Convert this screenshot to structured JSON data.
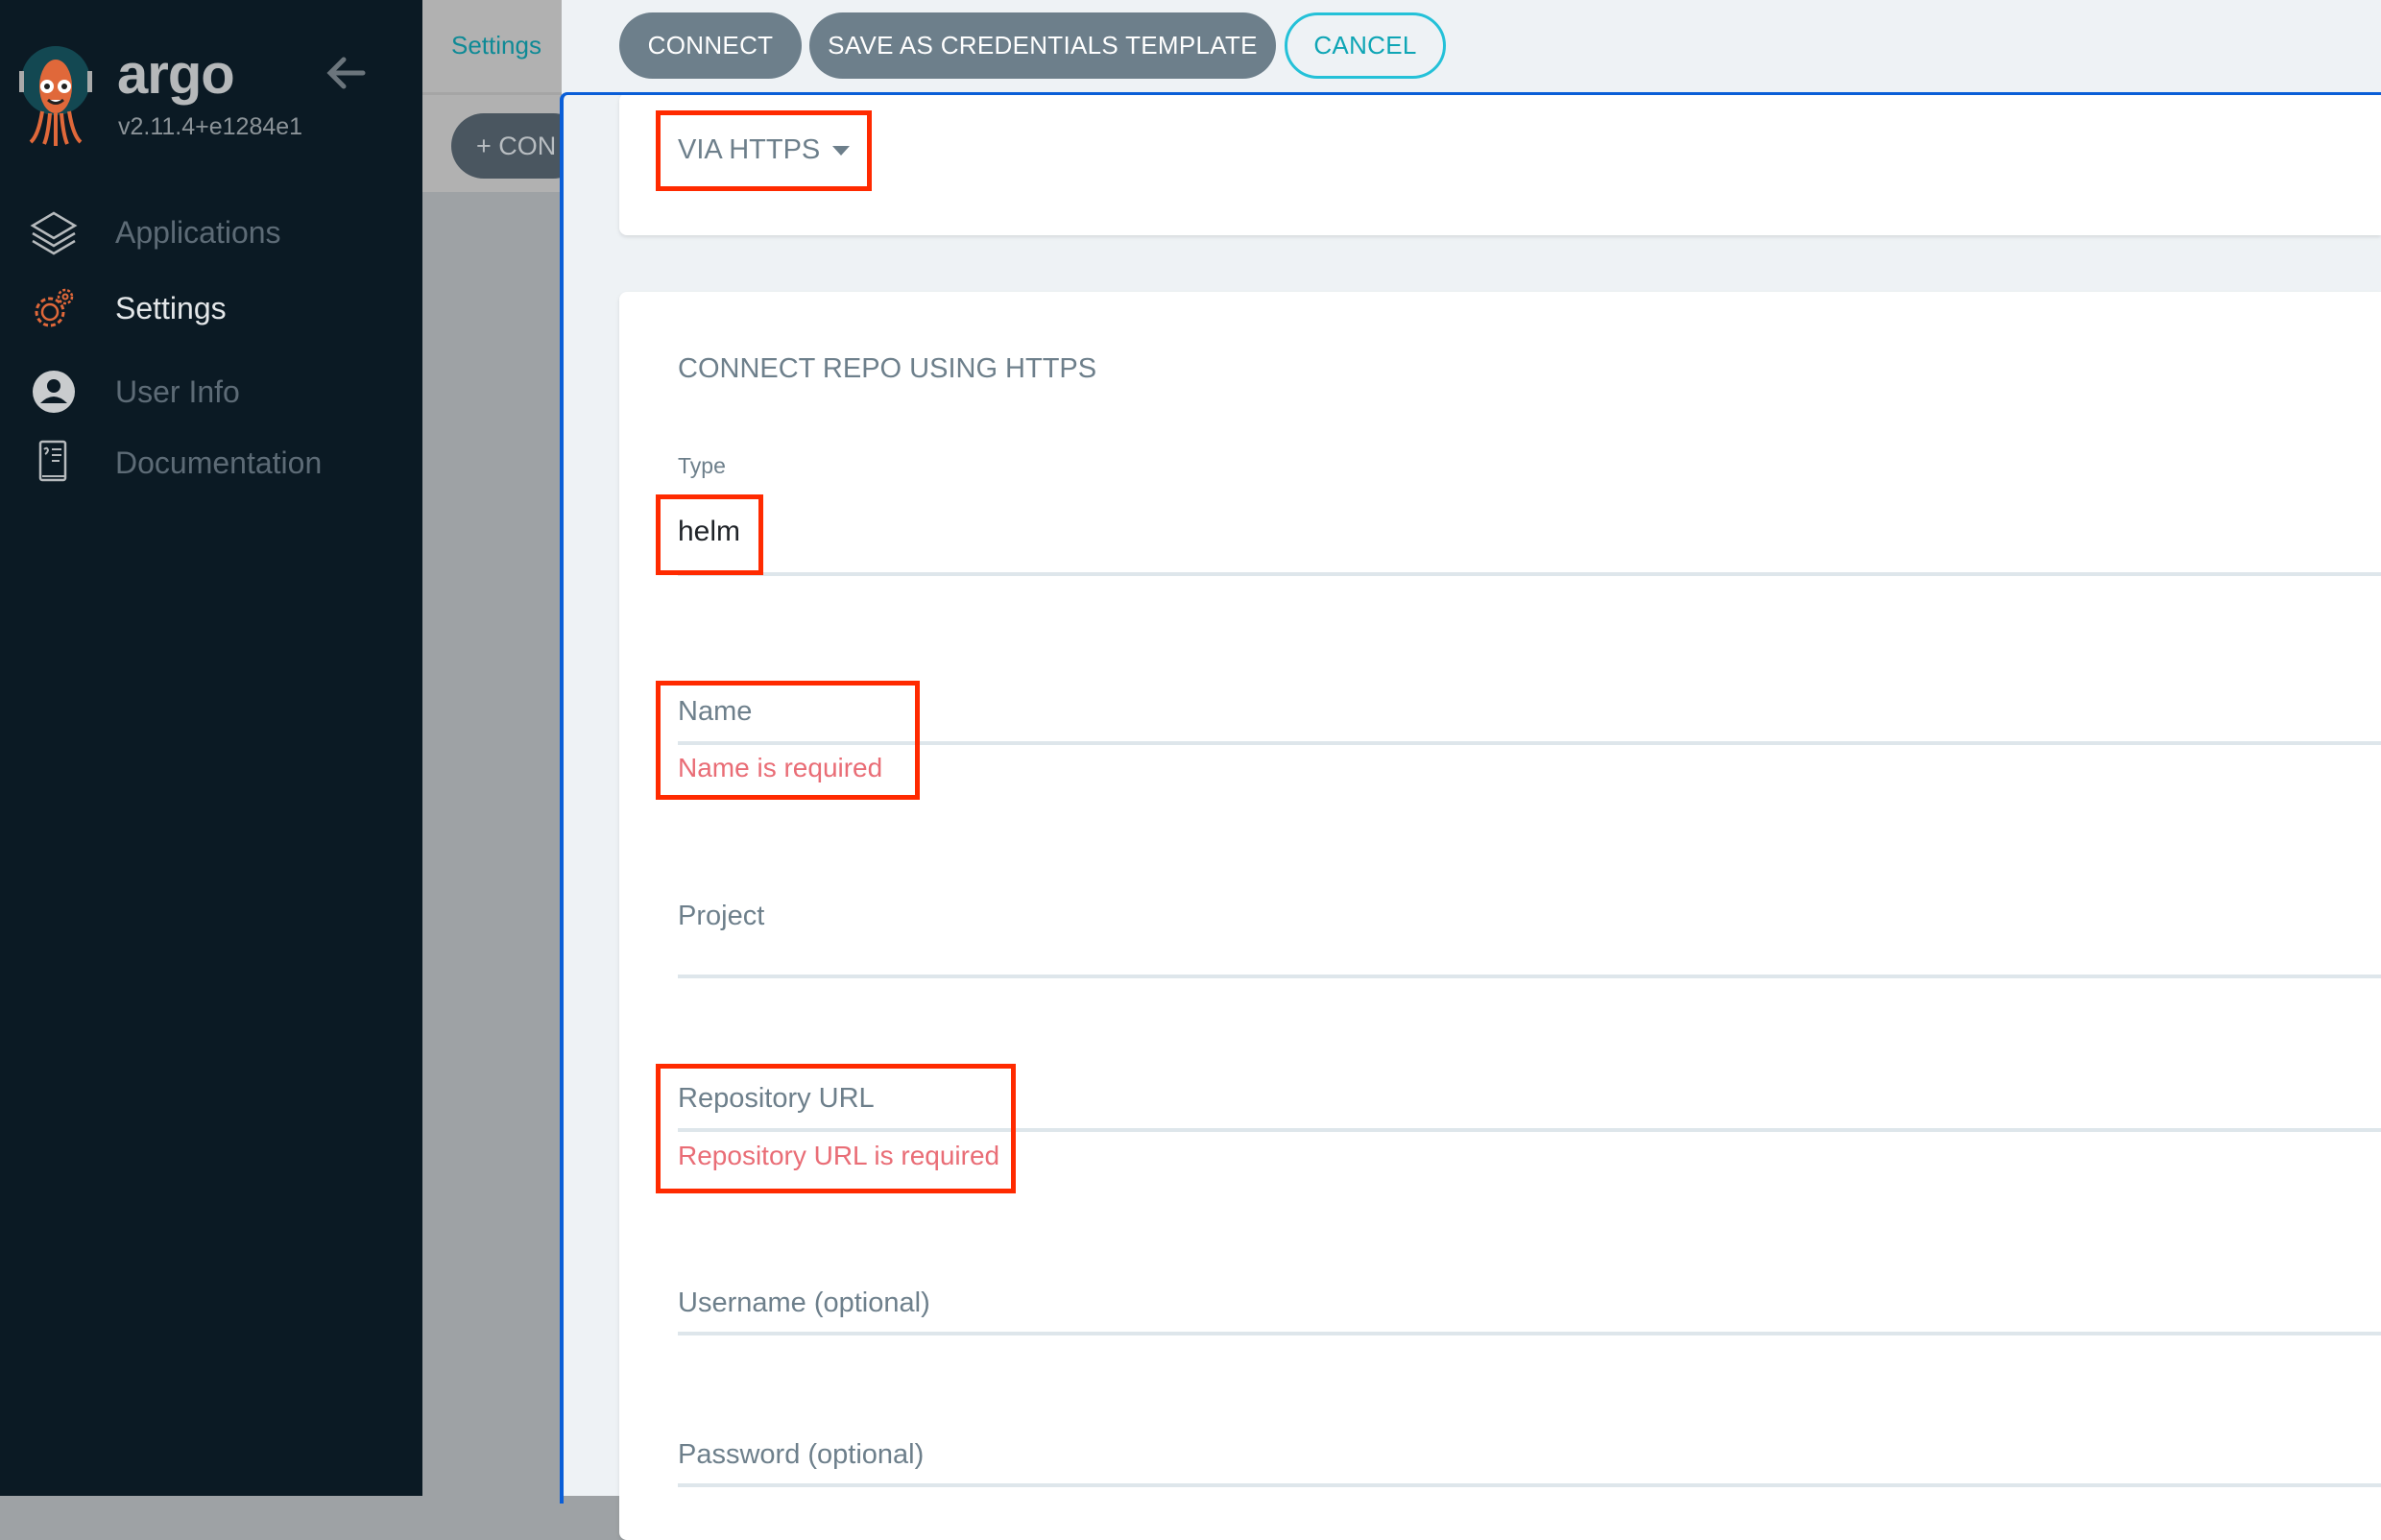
{
  "sidebar": {
    "brand": "argo",
    "version": "v2.11.4+e1284e1",
    "items": [
      {
        "label": "Applications",
        "icon": "layers-icon"
      },
      {
        "label": "Settings",
        "icon": "gears-icon",
        "active": true
      },
      {
        "label": "User Info",
        "icon": "user-circle-icon"
      },
      {
        "label": "Documentation",
        "icon": "book-icon"
      }
    ]
  },
  "background": {
    "breadcrumb": "Settings",
    "connect_repo_button": "+ CON"
  },
  "toolbar": {
    "connect": "CONNECT",
    "save_template": "SAVE AS CREDENTIALS TEMPLATE",
    "cancel": "CANCEL"
  },
  "form": {
    "method_dropdown": "VIA HTTPS",
    "heading": "CONNECT REPO USING HTTPS",
    "type_label": "Type",
    "type_value": "helm",
    "name_label": "Name",
    "name_error": "Name is required",
    "project_label": "Project",
    "repo_url_label": "Repository URL",
    "repo_url_error": "Repository URL is required",
    "username_label": "Username (optional)",
    "password_label": "Password (optional)"
  },
  "colors": {
    "sidebar_bg": "#0b1a24",
    "accent_teal": "#0ea5b5",
    "button_grey": "#6d7f8b",
    "error": "#e96d76",
    "highlight_box": "#ff2a00",
    "panel_border": "#0a5ed7"
  }
}
